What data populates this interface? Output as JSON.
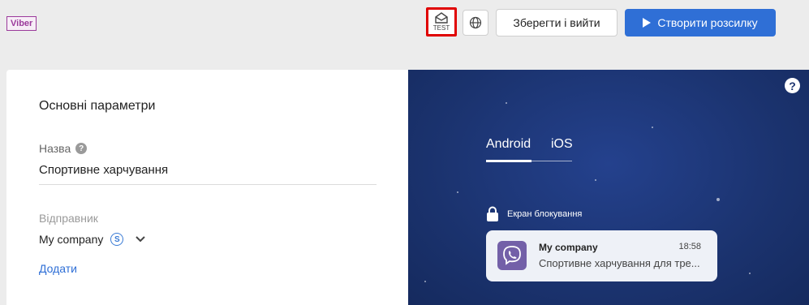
{
  "topbar": {
    "channel": "Viber",
    "test_label": "TEST",
    "save_label": "Зберегти і вийти",
    "create_label": "Створити розсилку"
  },
  "settings": {
    "section_title": "Основні параметри",
    "name_label": "Назва",
    "name_value": "Спортивне харчування",
    "sender_label": "Відправник",
    "sender_value": "My company",
    "sender_badge": "S",
    "add_label": "Додати"
  },
  "preview": {
    "help": "?",
    "tabs": [
      {
        "label": "Android",
        "active": true
      },
      {
        "label": "iOS",
        "active": false
      }
    ],
    "lock_label": "Екран блокування",
    "notification": {
      "sender": "My company",
      "time": "18:58",
      "text": "Спортивне харчування для тре..."
    }
  },
  "colors": {
    "accent": "#2f6fd6",
    "highlight_border": "#e00000",
    "channel_badge": "#9b3a9b",
    "preview_bg": "#1b336f",
    "viber_purple": "#7360a8"
  },
  "icons": [
    "test-mail-icon",
    "globe-icon",
    "play-icon",
    "help-icon",
    "s-icon",
    "chevron-down-icon",
    "lock-icon",
    "viber-icon"
  ]
}
